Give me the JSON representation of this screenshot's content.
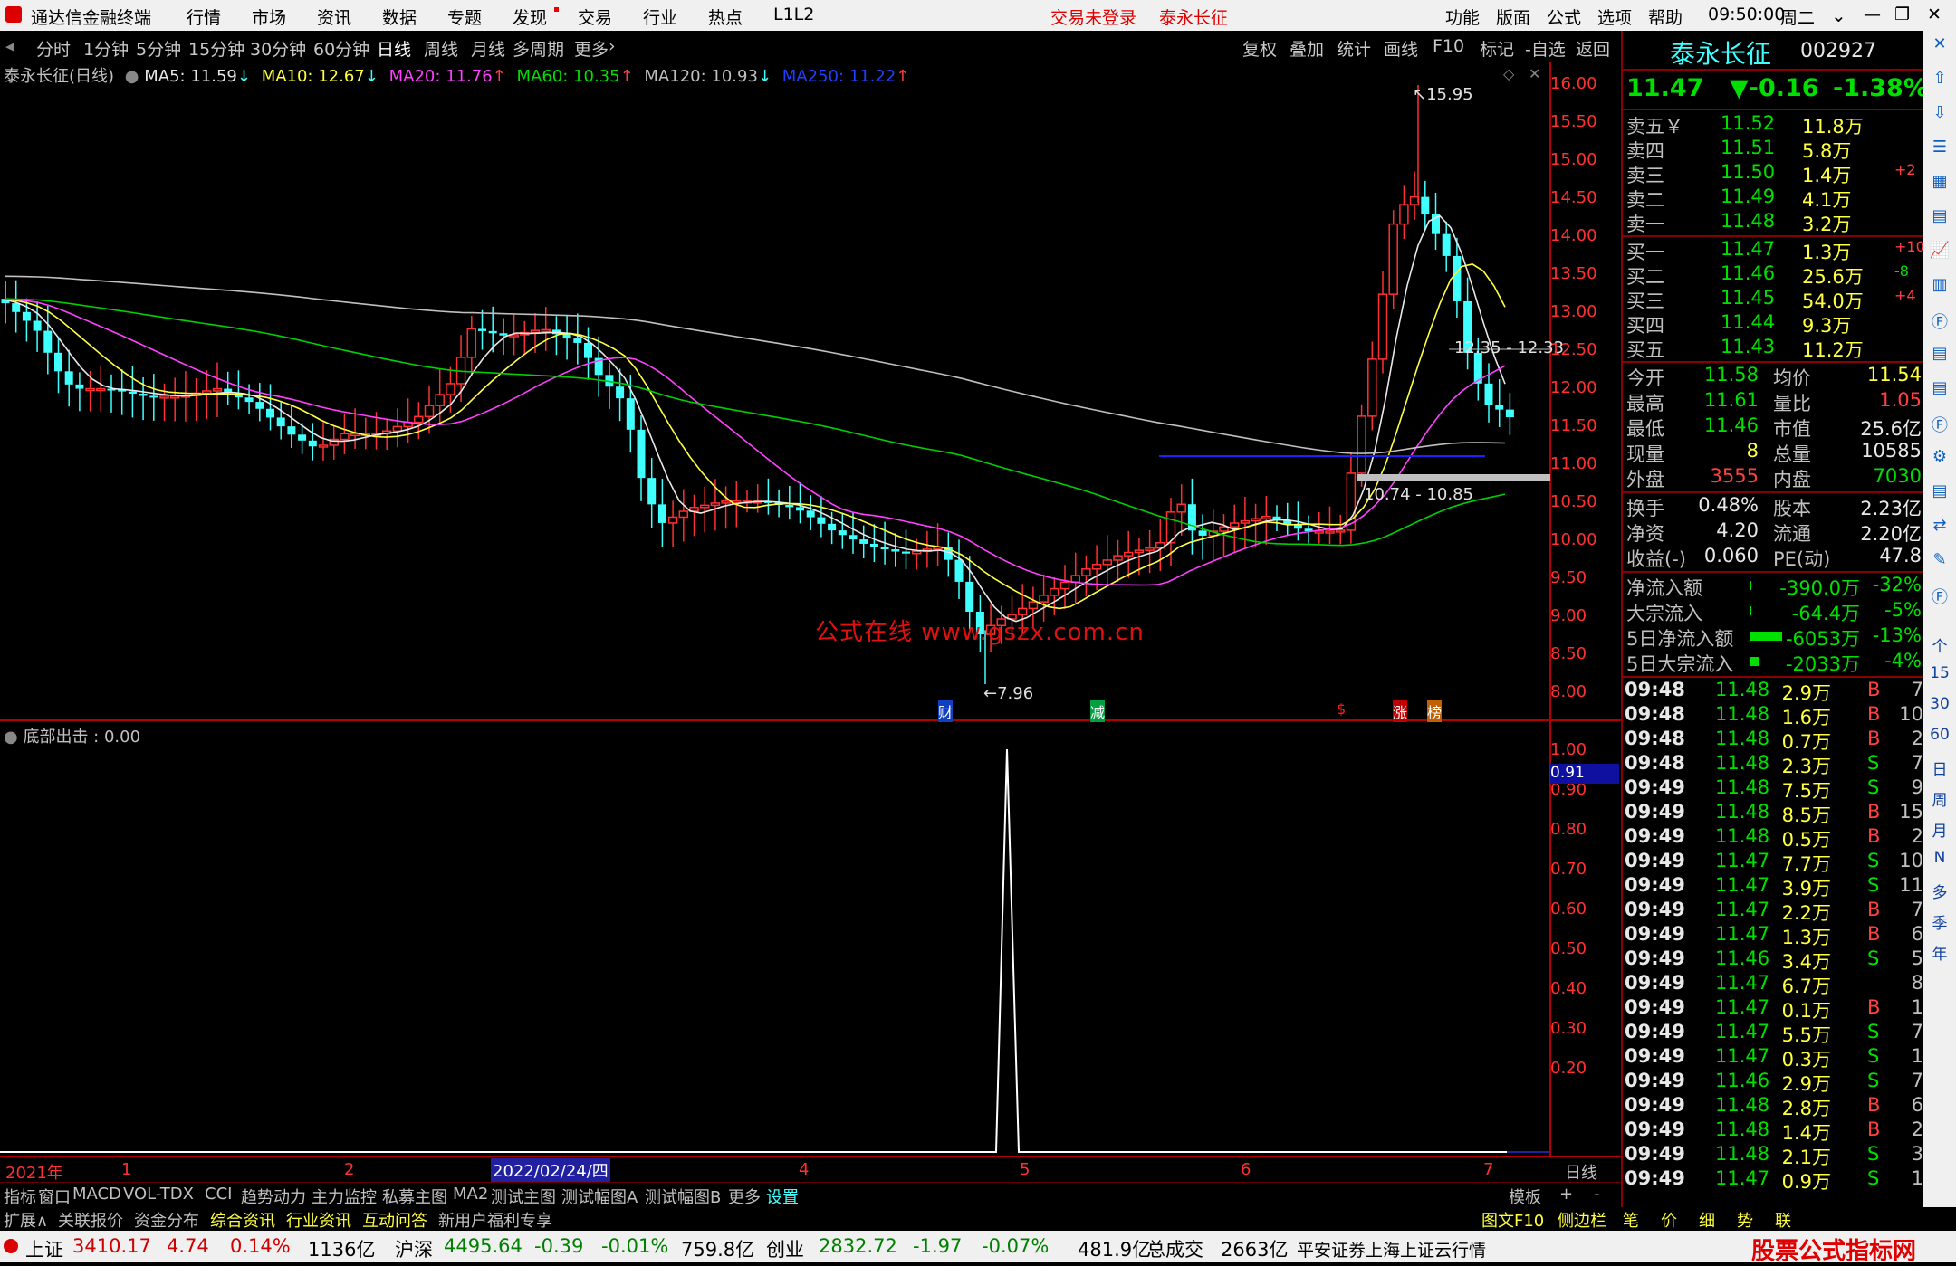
{
  "titlebar": {
    "app": "通达信金融终端",
    "menus": [
      "行情",
      "市场",
      "资讯",
      "数据",
      "专题",
      "发现",
      "交易",
      "行业",
      "热点",
      "L1L2"
    ],
    "notice1": "交易未登录",
    "notice2": "泰永长征",
    "right_menus": [
      "功能",
      "版面",
      "公式",
      "选项",
      "帮助"
    ],
    "time": "09:50:00",
    "weekday": "周二"
  },
  "periods": [
    "分时",
    "1分钟",
    "5分钟",
    "15分钟",
    "30分钟",
    "60分钟",
    "日线",
    "周线",
    "月线",
    "多周期",
    "更多"
  ],
  "active_period": "日线",
  "tools": [
    "复权",
    "叠加",
    "统计",
    "画线",
    "F10",
    "标记",
    "-自选",
    "返回"
  ],
  "chart_header": {
    "name": "泰永长征(日线)",
    "ma5": "MA5: 11.59",
    "ma10": "MA10: 12.67",
    "ma20": "MA20: 11.76",
    "ma60": "MA60: 10.35",
    "ma120": "MA120: 10.93",
    "ma250": "MA250: 11.22"
  },
  "annotations": {
    "high": "15.95",
    "low": "7.96",
    "range1": "12.35 - 12.33",
    "range2": "10.74 - 10.85",
    "watermark": "公式在线  www.gszx.com.cn",
    "marks": [
      "财",
      "减",
      "$",
      "涨",
      "榜"
    ]
  },
  "price_axis": [
    "16.00",
    "15.50",
    "15.00",
    "14.50",
    "14.00",
    "13.50",
    "13.00",
    "12.50",
    "12.00",
    "11.50",
    "11.00",
    "10.50",
    "10.00",
    "9.50",
    "9.00",
    "8.50",
    "8.00"
  ],
  "indicator": {
    "title": "底部出击 : 0.00",
    "axis": [
      "1.00",
      "0.90",
      "0.80",
      "0.70",
      "0.60",
      "0.50",
      "0.40",
      "0.30",
      "0.20"
    ],
    "marker": "0.91"
  },
  "time_axis": {
    "labels": [
      "2021年",
      "1",
      "2",
      "2022/02/24/四",
      "4",
      "5",
      "6",
      "7"
    ],
    "right": "日线"
  },
  "chart_data": {
    "type": "candlestick",
    "title": "泰永长征(日线)",
    "ylim": [
      7.96,
      15.95
    ],
    "indicator_series": {
      "name": "底部出击",
      "peak": 1.0,
      "peak_month": "5"
    }
  },
  "quote": {
    "name": "泰永长征",
    "code": "002927",
    "price": "11.47",
    "change": "▼-0.16",
    "pct": "-1.38%",
    "sells": [
      {
        "label": "卖五￥",
        "price": "11.52",
        "vol": "11.8万",
        "chg": ""
      },
      {
        "label": "卖四",
        "price": "11.51",
        "vol": "5.8万",
        "chg": ""
      },
      {
        "label": "卖三",
        "price": "11.50",
        "vol": "1.4万",
        "chg": "+2"
      },
      {
        "label": "卖二",
        "price": "11.49",
        "vol": "4.1万",
        "chg": ""
      },
      {
        "label": "卖一",
        "price": "11.48",
        "vol": "3.2万",
        "chg": ""
      }
    ],
    "buys": [
      {
        "label": "买一",
        "price": "11.47",
        "vol": "1.3万",
        "chg": "+10"
      },
      {
        "label": "买二",
        "price": "11.46",
        "vol": "25.6万",
        "chg": "-8"
      },
      {
        "label": "买三",
        "price": "11.45",
        "vol": "54.0万",
        "chg": "+4"
      },
      {
        "label": "买四",
        "price": "11.44",
        "vol": "9.3万",
        "chg": ""
      },
      {
        "label": "买五",
        "price": "11.43",
        "vol": "11.2万",
        "chg": ""
      }
    ],
    "stats": [
      {
        "l1": "今开",
        "v1": "11.58",
        "l2": "均价",
        "v2": "11.54"
      },
      {
        "l1": "最高",
        "v1": "11.61",
        "l2": "量比",
        "v2": "1.05"
      },
      {
        "l1": "最低",
        "v1": "11.46",
        "l2": "市值",
        "v2": "25.6亿"
      },
      {
        "l1": "现量",
        "v1": "8",
        "l2": "总量",
        "v2": "10585"
      },
      {
        "l1": "外盘",
        "v1": "3555",
        "l2": "内盘",
        "v2": "7030"
      }
    ],
    "fund": [
      {
        "l1": "换手",
        "v1": "0.48%",
        "l2": "股本",
        "v2": "2.23亿"
      },
      {
        "l1": "净资",
        "v1": "4.20",
        "l2": "流通",
        "v2": "2.20亿"
      },
      {
        "l1": "收益(-)",
        "v1": "0.060",
        "l2": "PE(动)",
        "v2": "47.8"
      }
    ],
    "flows": [
      {
        "label": "净流入额",
        "value": "-390.0万",
        "pct": "-32%"
      },
      {
        "label": "大宗流入",
        "value": "-64.4万",
        "pct": "-5%"
      },
      {
        "label": "5日净流入额",
        "value": "-6053万",
        "pct": "-13%"
      },
      {
        "label": "5日大宗流入",
        "value": "-2033万",
        "pct": "-4%"
      }
    ],
    "ticks": [
      {
        "t": "09:48",
        "p": "11.48",
        "v": "2.9万",
        "bs": "B",
        "n": "7"
      },
      {
        "t": "09:48",
        "p": "11.48",
        "v": "1.6万",
        "bs": "B",
        "n": "10"
      },
      {
        "t": "09:48",
        "p": "11.48",
        "v": "0.7万",
        "bs": "B",
        "n": "2"
      },
      {
        "t": "09:48",
        "p": "11.48",
        "v": "2.3万",
        "bs": "S",
        "n": "7"
      },
      {
        "t": "09:49",
        "p": "11.48",
        "v": "7.5万",
        "bs": "S",
        "n": "9"
      },
      {
        "t": "09:49",
        "p": "11.48",
        "v": "8.5万",
        "bs": "B",
        "n": "15"
      },
      {
        "t": "09:49",
        "p": "11.48",
        "v": "0.5万",
        "bs": "B",
        "n": "2"
      },
      {
        "t": "09:49",
        "p": "11.47",
        "v": "7.7万",
        "bs": "S",
        "n": "10"
      },
      {
        "t": "09:49",
        "p": "11.47",
        "v": "3.9万",
        "bs": "S",
        "n": "11"
      },
      {
        "t": "09:49",
        "p": "11.47",
        "v": "2.2万",
        "bs": "B",
        "n": "7"
      },
      {
        "t": "09:49",
        "p": "11.47",
        "v": "1.3万",
        "bs": "B",
        "n": "6"
      },
      {
        "t": "09:49",
        "p": "11.46",
        "v": "3.4万",
        "bs": "S",
        "n": "5"
      },
      {
        "t": "09:49",
        "p": "11.47",
        "v": "6.7万",
        "bs": "",
        "n": "8"
      },
      {
        "t": "09:49",
        "p": "11.47",
        "v": "0.1万",
        "bs": "B",
        "n": "1"
      },
      {
        "t": "09:49",
        "p": "11.47",
        "v": "5.5万",
        "bs": "S",
        "n": "7"
      },
      {
        "t": "09:49",
        "p": "11.47",
        "v": "0.3万",
        "bs": "S",
        "n": "1"
      },
      {
        "t": "09:49",
        "p": "11.46",
        "v": "2.9万",
        "bs": "S",
        "n": "7"
      },
      {
        "t": "09:49",
        "p": "11.48",
        "v": "2.8万",
        "bs": "B",
        "n": "6"
      },
      {
        "t": "09:49",
        "p": "11.48",
        "v": "1.4万",
        "bs": "B",
        "n": "2"
      },
      {
        "t": "09:49",
        "p": "11.48",
        "v": "2.1万",
        "bs": "S",
        "n": "3"
      },
      {
        "t": "09:49",
        "p": "11.47",
        "v": "0.9万",
        "bs": "S",
        "n": "1"
      }
    ]
  },
  "side_icons": [
    "个",
    "15",
    "30",
    "60",
    "日",
    "周",
    "月",
    "N",
    "多",
    "季",
    "年"
  ],
  "tabs1": [
    "指标",
    "窗口",
    "MACD",
    "VOL-TDX",
    "CCI",
    "趋势动力",
    "主力监控",
    "私募主图",
    "MA2",
    "测试主图",
    "测试幅图A",
    "测试幅图B",
    "更多",
    "设置"
  ],
  "tabs1_right": [
    "模板",
    "+",
    "-"
  ],
  "tabs2": [
    "扩展∧",
    "关联报价",
    "资金分布",
    "综合资讯",
    "行业资讯",
    "互动问答",
    "新用户福利专享"
  ],
  "tabs2_right": [
    "图文F10",
    "侧边栏《",
    "笔",
    "价",
    "细",
    "势",
    "联"
  ],
  "status": {
    "sh_label": "上证",
    "sh": "3410.17",
    "sh_chg": "4.74",
    "sh_pct": "0.14%",
    "sh_amt": "1136亿",
    "hs_label": "沪深",
    "hs": "4495.64",
    "hs_chg": "-0.39",
    "hs_pct": "-0.01%",
    "hs_amt": "759.8亿",
    "cy_label": "创业",
    "cy": "2832.72",
    "cy_chg": "-1.97",
    "cy_pct": "-0.07%",
    "cy_amt": "481.9亿",
    "total_label": "总成交",
    "total": "2663亿",
    "source": "平安证券上海上证云行情",
    "logo": "股票公式指标网",
    "logo_url": "www.gszx.com.cn"
  }
}
